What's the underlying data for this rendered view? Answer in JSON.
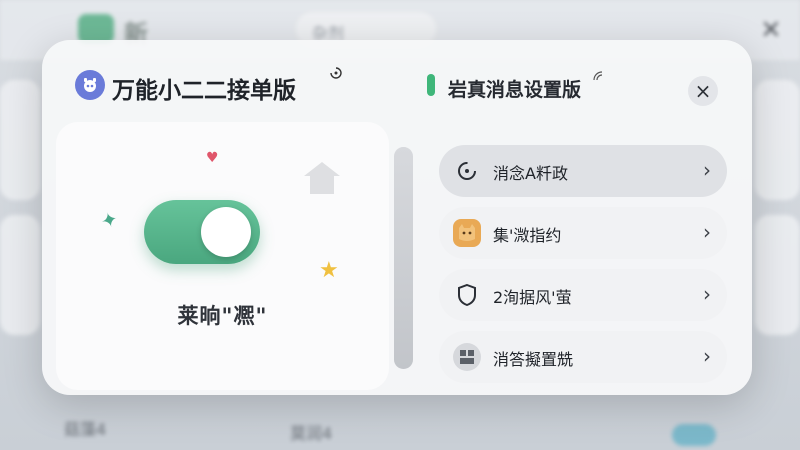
{
  "background": {
    "app_title": "新",
    "search_text": "杂剂",
    "card_labels": [
      "菇藻4",
      "莫润4"
    ],
    "close_glyph": "×"
  },
  "dialog": {
    "app_title": "万能小二二接单版",
    "settings_title": "岩真消息设置版",
    "close_glyph": "×",
    "toggle": {
      "label": "莱晌\"凞\"",
      "state": "on",
      "color": "#55b58a"
    },
    "menu": [
      {
        "label": "消念A粁政",
        "icon": "timer-icon",
        "active": true
      },
      {
        "label": "集'溦指约",
        "icon": "cat-icon",
        "active": false
      },
      {
        "label": "2洵据风'萤",
        "icon": "shield-icon",
        "active": false
      },
      {
        "label": "消答擬置兟",
        "icon": "grid-icon",
        "active": false
      }
    ],
    "chevron": "›"
  },
  "colors": {
    "accent_green": "#55b58a",
    "badge_blue": "#6a7bd9",
    "tab_green": "#3fb67a"
  }
}
